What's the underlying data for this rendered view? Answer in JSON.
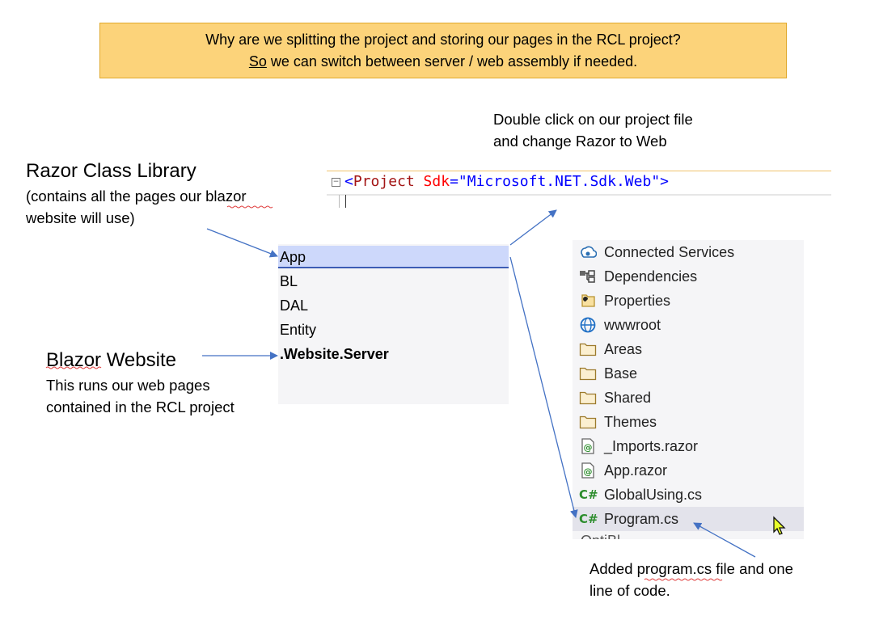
{
  "banner": {
    "line1": "Why are we splitting the project  and storing our pages in the RCL project?",
    "line2_underlined": "So",
    "line2_rest": " we can switch between server / web assembly if needed."
  },
  "instruction": {
    "line1": "Double click on our project file",
    "line2": "and change Razor to Web"
  },
  "code": {
    "open": "<",
    "tag": "Project",
    "attr": " Sdk",
    "eq": "=",
    "value": "\"Microsoft.NET.Sdk.Web\"",
    "close": ">"
  },
  "rcl": {
    "title": "Razor Class Library",
    "desc1": "(contains all the pages our blazor",
    "desc2": "website will use)"
  },
  "blazor": {
    "title": "Blazor Website",
    "desc1": "This runs our web pages",
    "desc2": "contained in the RCL project"
  },
  "projects": [
    {
      "label": "App"
    },
    {
      "label": "BL"
    },
    {
      "label": "DAL"
    },
    {
      "label": "Entity"
    },
    {
      "label": ".Website.Server"
    }
  ],
  "solution_items": [
    {
      "label": "Connected Services",
      "icon": "connected-services-icon"
    },
    {
      "label": "Dependencies",
      "icon": "dependencies-icon"
    },
    {
      "label": "Properties",
      "icon": "wrench-folder-icon"
    },
    {
      "label": "wwwroot",
      "icon": "globe-icon"
    },
    {
      "label": "Areas",
      "icon": "folder-icon"
    },
    {
      "label": "Base",
      "icon": "folder-icon"
    },
    {
      "label": "Shared",
      "icon": "folder-icon"
    },
    {
      "label": "Themes",
      "icon": "folder-icon"
    },
    {
      "label": "_Imports.razor",
      "icon": "razor-file-icon"
    },
    {
      "label": "App.razor",
      "icon": "razor-file-icon"
    },
    {
      "label": "GlobalUsing.cs",
      "icon": "csharp-icon"
    },
    {
      "label": "Program.cs",
      "icon": "csharp-icon"
    }
  ],
  "solution_cutoff": "OptiBl",
  "csharp_glyph": "C#",
  "added_note": {
    "line1": "Added program.cs file and one",
    "line2": "line of code."
  },
  "colors": {
    "banner_bg": "#fcd37a",
    "selection": "#cdd8fb",
    "arrow": "#4472c4",
    "csharp": "#2d8d2d"
  }
}
